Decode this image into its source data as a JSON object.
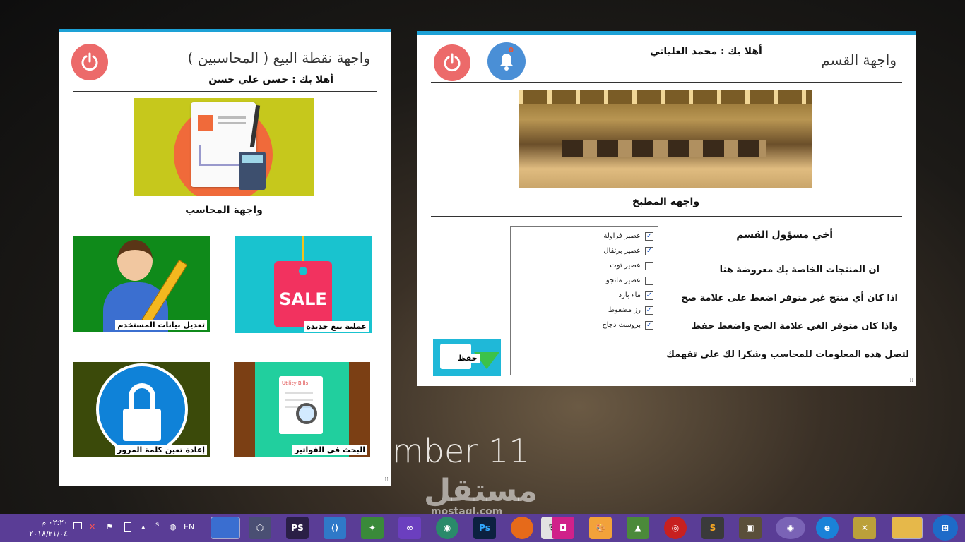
{
  "desktop": {
    "date_text": "mber 11",
    "watermark": "مستقل",
    "watermark_sub": "mostaql.com"
  },
  "left_window": {
    "title": "واجهة نقطة البيع ( المحاسبين )",
    "welcome": "أهلا بك : حسن علي حسن",
    "accountant_caption": "واجهة المحاسب",
    "tiles": {
      "new_sale": "عملية بيع جديدة",
      "edit_user": "تعديل بيانات المستخدم",
      "search_invoices": "البحث في الفواتير",
      "reset_password": "إعادة تعين كلمة المرور",
      "sale_tag_text": "SALE",
      "utility_bills_text": "Utility Bills"
    }
  },
  "right_window": {
    "title": "واجهة القسم",
    "welcome": "أهلا بك : محمد العلياني",
    "notification_count": "0",
    "kitchen_caption": "واجهة المطبخ",
    "save_label": "حفظ",
    "items": [
      {
        "label": "عصير فراولة",
        "checked": true
      },
      {
        "label": "عصير برتقال",
        "checked": true
      },
      {
        "label": "عصير توت",
        "checked": false
      },
      {
        "label": "عصير مانجو",
        "checked": false
      },
      {
        "label": "ماء بارد",
        "checked": true
      },
      {
        "label": "رز مضغوط",
        "checked": true
      },
      {
        "label": "بروست دجاج",
        "checked": true
      }
    ],
    "info": {
      "greeting": "أخي مسؤول القسم",
      "line1": "ان المنتجات الخاصة بك معروضة هنا",
      "line2": "اذا كان أي منتج غير متوفر اضغط على علامة صح",
      "line3": "واذا كان متوفر الغي علامة الصح واضغط حفظ",
      "line4": "لتصل هذه المعلومات للمحاسب وشكرا لك على تفهمك"
    }
  },
  "taskbar": {
    "time": "٠٢:٢٠ م",
    "date": "٢٠١٨/٢١/٠٤",
    "language": "EN",
    "ps_label": "PS",
    "ps2_label": "Ps"
  }
}
